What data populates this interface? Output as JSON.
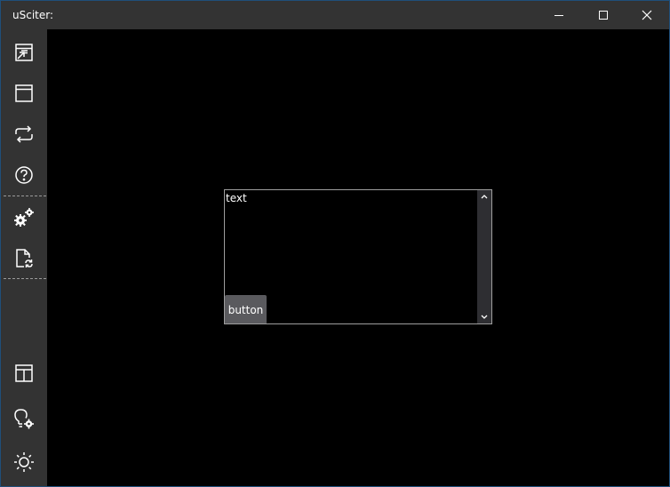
{
  "window": {
    "title": "uSciter:"
  },
  "titlebar": {
    "buttons": [
      {
        "name": "minimize",
        "icon": "minimize-icon"
      },
      {
        "name": "maximize",
        "icon": "maximize-icon"
      },
      {
        "name": "close",
        "icon": "close-icon"
      }
    ]
  },
  "sidebar": {
    "icon_color": "#ffffff",
    "items": [
      {
        "icon": "window-export-icon"
      },
      {
        "icon": "window-icon"
      },
      {
        "icon": "refresh-icon"
      },
      {
        "icon": "help-icon"
      },
      {
        "icon": "settings-gears-icon"
      },
      {
        "icon": "file-sync-icon"
      },
      {
        "icon": "layout-panel-icon"
      },
      {
        "icon": "lightbulb-settings-icon"
      },
      {
        "icon": "brightness-icon"
      }
    ]
  },
  "main": {
    "textarea": {
      "value": "text"
    },
    "button": {
      "label": "button"
    }
  },
  "colors": {
    "titlebar_bg": "#333333",
    "sidebar_bg": "#333333",
    "content_bg": "#000000",
    "button_bg": "#5a5a5e",
    "border": "#9e9e9e",
    "window_frame": "#1f4f7a"
  }
}
